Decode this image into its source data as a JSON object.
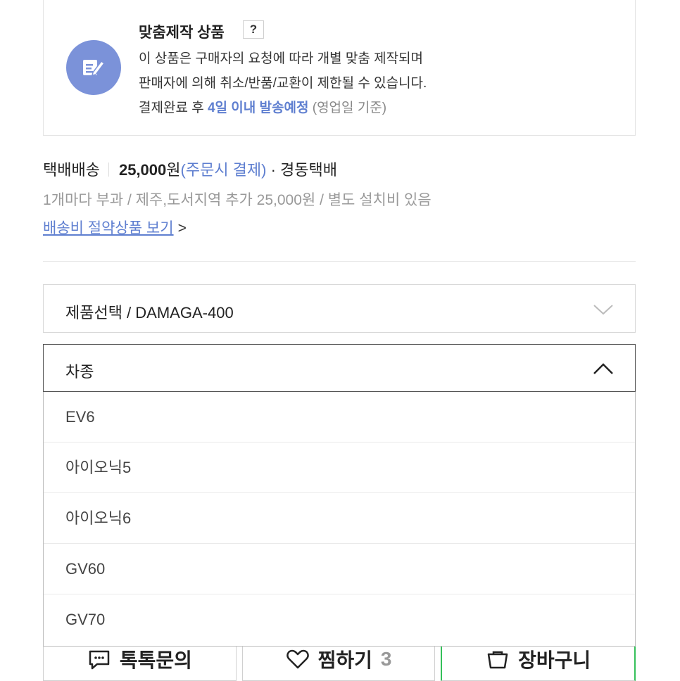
{
  "custom": {
    "title": "맞춤제작 상품",
    "help": "?",
    "line1": "이 상품은 구매자의 요청에 따라 개별 맞춤 제작되며",
    "line2": "판매자에 의해 취소/반품/교환이 제한될 수 있습니다.",
    "line3_prefix": "결제완료 후 ",
    "line3_highlight": "4일 이내 발송예정",
    "line3_suffix": " (영업일 기준)",
    "icon": "edit-note-icon"
  },
  "shipping": {
    "method": "택배배송",
    "price": "25,000",
    "currency": "원",
    "payment": "(주문시 결제)",
    "carrier": "· 경동택배",
    "note": "1개마다 부과 / 제주,도서지역 추가 25,000원 / 별도 설치비 있음",
    "link": "배송비 절약상품 보기",
    "link_chevron": ">"
  },
  "product_select": {
    "label": "제품선택 / DAMAGA-400"
  },
  "car_select": {
    "label": "차종",
    "options": [
      "EV6",
      "아이오닉5",
      "아이오닉6",
      "GV60",
      "GV70"
    ]
  },
  "bottom_bar": {
    "talk_label": "톡톡문의",
    "wish_label": "찜하기",
    "wish_count": "3",
    "cart_label": "장바구니"
  },
  "colors": {
    "accent": "#5f7fd0",
    "icon_circle": "#7b92d9",
    "cart_border": "#35c05a"
  }
}
